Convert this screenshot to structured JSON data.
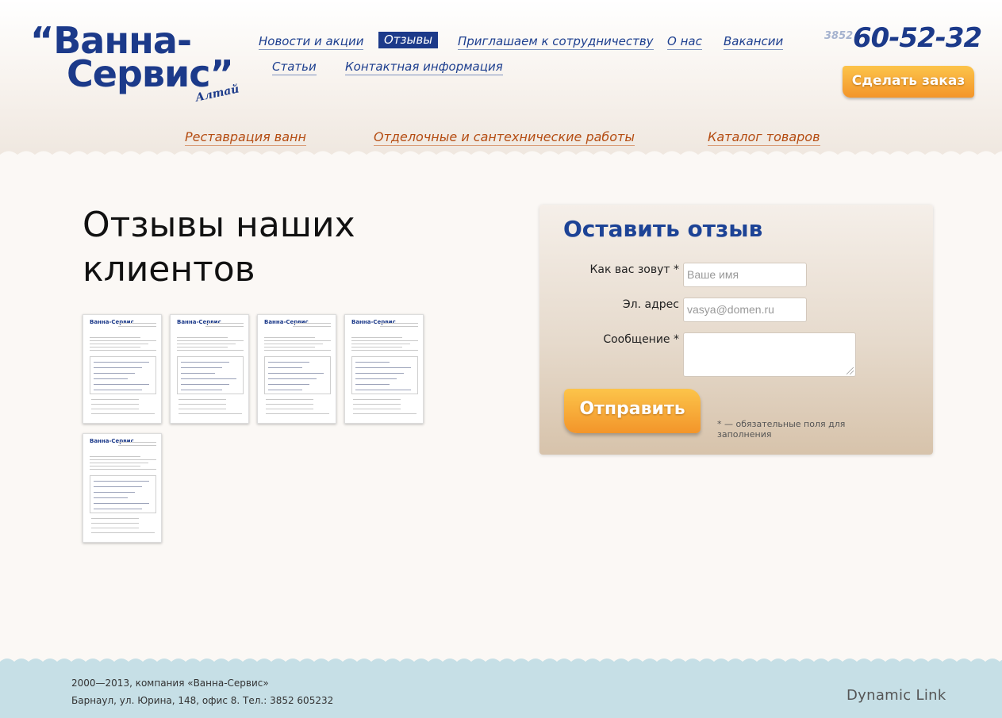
{
  "logo": {
    "line1": "“Ванна-",
    "line2": "Сервис”",
    "sub": "Алтай"
  },
  "topnav": [
    {
      "label": "Новости и акции",
      "active": false
    },
    {
      "label": "Отзывы",
      "active": true
    },
    {
      "label": "Приглашаем к сотрудничеству",
      "active": false
    },
    {
      "label": "О нас",
      "active": false
    },
    {
      "label": "Вакансии",
      "active": false
    },
    {
      "label": "Статьи",
      "active": false
    },
    {
      "label": "Контактная информация",
      "active": false
    }
  ],
  "phone": {
    "code": "3852",
    "number": "60-52-32"
  },
  "order_button": "Сделать заказ",
  "subnav": [
    "Реставрация ванн",
    "Отделочные и сантехнические работы",
    "Каталог товаров"
  ],
  "main": {
    "title": "Отзывы наших клиентов"
  },
  "review_thumbs": [
    {
      "logo": "Ванна-Сервис"
    },
    {
      "logo": "Ванна-Сервис"
    },
    {
      "logo": "Ванна-Сервис"
    },
    {
      "logo": "Ванна-Сервис"
    },
    {
      "logo": "Ванна-Сервис"
    }
  ],
  "form": {
    "title": "Оставить отзыв",
    "name_label": "Как вас зовут *",
    "name_placeholder": "Ваше имя",
    "email_label": "Эл. адрес",
    "email_placeholder": "vasya@domen.ru",
    "message_label": "Сообщение *",
    "submit": "Отправить",
    "required_note": "* — обязательные поля для заполнения"
  },
  "footer": {
    "copyright": "2000—2013, компания «Ванна-Сервис»",
    "address": "Барнаул, ул. Юрина, 148, офис 8. Тел.: 3852 605232",
    "developer": "Dynamic Link"
  },
  "colors": {
    "brand": "#1c3a8a",
    "accent": "#f3952a",
    "footer": "#c6dfe6",
    "subnav": "#b54d13"
  }
}
